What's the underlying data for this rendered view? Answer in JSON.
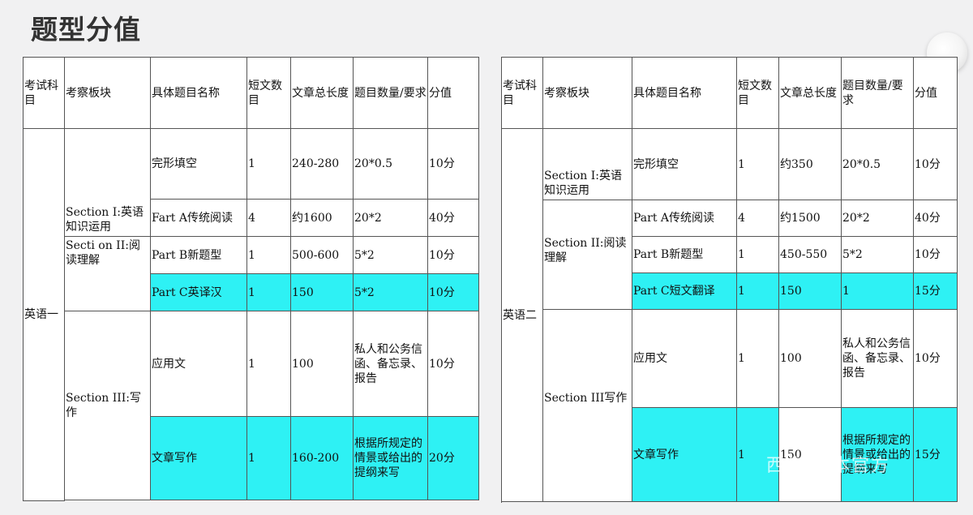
{
  "title": "题型分值",
  "watermark": "西华网  本官方",
  "headers": [
    "考试科目",
    "考察板块",
    "具体题目名称",
    "短文数目",
    "文章总长度",
    "题目数量/要求",
    "分值"
  ],
  "table1": {
    "exam": "英语一",
    "sections": [
      "Section I:英语知识运用",
      "Secti on II:阅读理解",
      "Section III:写作"
    ],
    "rows": [
      [
        "完形填空",
        "1",
        "240-280",
        "20*0.5",
        "10分"
      ],
      [
        "Fart A传统阅读",
        "4",
        "约1600",
        "20*2",
        "40分"
      ],
      [
        "Part B新题型",
        "1",
        "500-600",
        "5*2",
        "10分"
      ],
      [
        "Part C英译汉",
        "1",
        "150",
        "5*2",
        "10分"
      ],
      [
        "应用文",
        "1",
        "100",
        "私人和公务信函、备忘录、报告",
        "10分"
      ],
      [
        "文章写作",
        "1",
        "160-200",
        "根据所规定的情景或给出的提纲来写",
        "20分"
      ]
    ]
  },
  "table2": {
    "exam": "英语二",
    "sections": [
      "Section I:英语知识运用",
      "Section II:阅读理解",
      "Section III写作"
    ],
    "rows": [
      [
        "完形填空",
        "1",
        "约350",
        "20*0.5",
        "10分"
      ],
      [
        "Part A传统阅读",
        "4",
        "约1500",
        "20*2",
        "40分"
      ],
      [
        "Part B新题型",
        "1",
        "450-550",
        "5*2",
        "10分"
      ],
      [
        "Part C短文翻译",
        "1",
        "150",
        "1",
        "15分"
      ],
      [
        "应用文",
        "1",
        "100",
        "私人和公务信函、备忘录、报告",
        "10分"
      ],
      [
        "文章写作",
        "1",
        "150",
        "根据所规定的情景或给出的提纲来写",
        "15分"
      ]
    ]
  }
}
